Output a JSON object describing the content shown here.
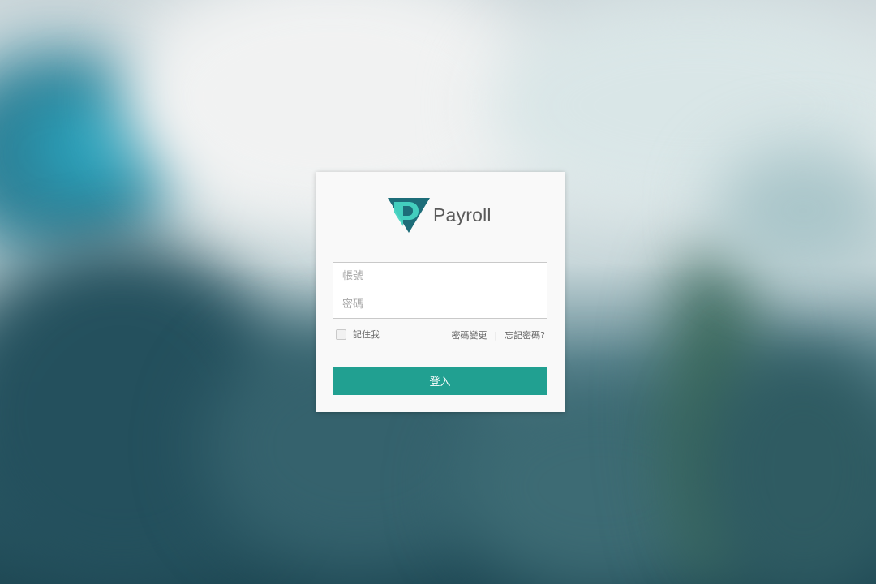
{
  "brand": {
    "name": "Payroll",
    "colors": {
      "dark": "#1d6d79",
      "light": "#46d4c2",
      "accent": "#21a091"
    }
  },
  "login": {
    "username_placeholder": "帳號",
    "password_placeholder": "密碼",
    "remember_label": "記住我",
    "change_password_link": "密碼變更",
    "separator": "|",
    "forgot_password_link": "忘記密碼?",
    "submit_label": "登入"
  },
  "footer": {
    "mark": ""
  }
}
